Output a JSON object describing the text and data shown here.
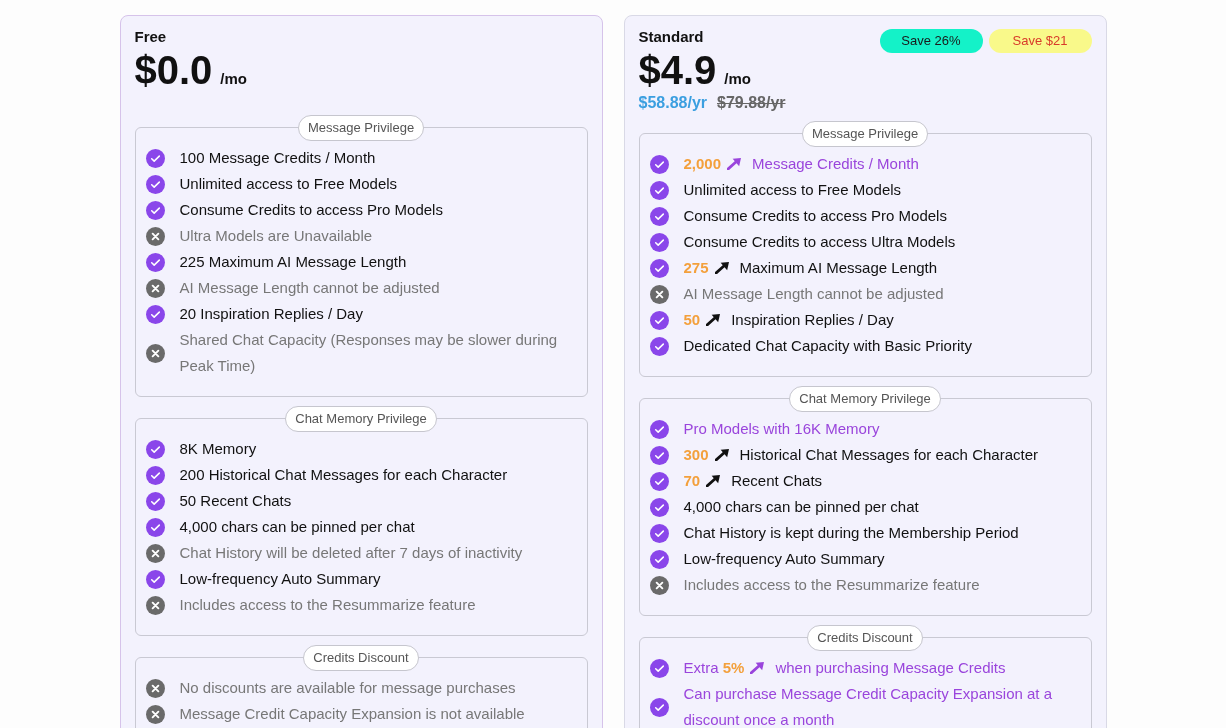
{
  "plans": [
    {
      "name": "Free",
      "price": "$0.0",
      "period": "/mo",
      "sections": [
        {
          "title": "Message Privilege",
          "features": [
            {
              "included": true,
              "highlight": false,
              "segments": [
                {
                  "kind": "text",
                  "text": "100 Message Credits / Month"
                }
              ]
            },
            {
              "included": true,
              "highlight": false,
              "segments": [
                {
                  "kind": "text",
                  "text": "Unlimited access to Free Models"
                }
              ]
            },
            {
              "included": true,
              "highlight": false,
              "segments": [
                {
                  "kind": "text",
                  "text": "Consume Credits to access Pro Models"
                }
              ]
            },
            {
              "included": false,
              "highlight": false,
              "segments": [
                {
                  "kind": "text",
                  "text": "Ultra Models are Unavailable"
                }
              ]
            },
            {
              "included": true,
              "highlight": false,
              "segments": [
                {
                  "kind": "text",
                  "text": "225 Maximum AI Message Length"
                }
              ]
            },
            {
              "included": false,
              "highlight": false,
              "segments": [
                {
                  "kind": "text",
                  "text": "AI Message Length cannot be adjusted"
                }
              ]
            },
            {
              "included": true,
              "highlight": false,
              "segments": [
                {
                  "kind": "text",
                  "text": "20 Inspiration Replies / Day"
                }
              ]
            },
            {
              "included": false,
              "highlight": false,
              "segments": [
                {
                  "kind": "text",
                  "text": "Shared Chat Capacity (Responses may be slower during Peak Time)"
                }
              ]
            }
          ]
        },
        {
          "title": "Chat Memory Privilege",
          "features": [
            {
              "included": true,
              "highlight": false,
              "segments": [
                {
                  "kind": "text",
                  "text": "8K Memory"
                }
              ]
            },
            {
              "included": true,
              "highlight": false,
              "segments": [
                {
                  "kind": "text",
                  "text": "200 Historical Chat Messages for each Character"
                }
              ]
            },
            {
              "included": true,
              "highlight": false,
              "segments": [
                {
                  "kind": "text",
                  "text": "50 Recent Chats"
                }
              ]
            },
            {
              "included": true,
              "highlight": false,
              "segments": [
                {
                  "kind": "text",
                  "text": "4,000 chars can be pinned per chat"
                }
              ]
            },
            {
              "included": false,
              "highlight": false,
              "segments": [
                {
                  "kind": "text",
                  "text": "Chat History will be deleted after 7 days of inactivity"
                }
              ]
            },
            {
              "included": true,
              "highlight": false,
              "segments": [
                {
                  "kind": "text",
                  "text": "Low-frequency Auto Summary"
                }
              ]
            },
            {
              "included": false,
              "highlight": false,
              "segments": [
                {
                  "kind": "text",
                  "text": "Includes access to the Resummarize feature"
                }
              ]
            }
          ]
        },
        {
          "title": "Credits Discount",
          "features": [
            {
              "included": false,
              "highlight": false,
              "segments": [
                {
                  "kind": "text",
                  "text": "No discounts are available for message purchases"
                }
              ]
            },
            {
              "included": false,
              "highlight": false,
              "segments": [
                {
                  "kind": "text",
                  "text": "Message Credit Capacity Expansion is not available"
                }
              ]
            }
          ]
        }
      ]
    },
    {
      "name": "Standard",
      "price": "$4.9",
      "period": "/mo",
      "yearly_price": "$58.88/yr",
      "original_yearly_price": "$79.88/yr",
      "badges": [
        {
          "kind": "percent",
          "text": "Save 26%",
          "color": "#14f2c8"
        },
        {
          "kind": "amount",
          "text": "Save $21",
          "color": "#f9f98a"
        }
      ],
      "sections": [
        {
          "title": "Message Privilege",
          "features": [
            {
              "included": true,
              "highlight": true,
              "segments": [
                {
                  "kind": "number",
                  "text": "2,000"
                },
                {
                  "kind": "arrow"
                },
                {
                  "kind": "text",
                  "text": "Message Credits / Month"
                }
              ]
            },
            {
              "included": true,
              "highlight": false,
              "segments": [
                {
                  "kind": "text",
                  "text": "Unlimited access to Free Models"
                }
              ]
            },
            {
              "included": true,
              "highlight": false,
              "segments": [
                {
                  "kind": "text",
                  "text": "Consume Credits to access Pro Models"
                }
              ]
            },
            {
              "included": true,
              "highlight": false,
              "segments": [
                {
                  "kind": "text",
                  "text": "Consume Credits to access Ultra Models"
                }
              ]
            },
            {
              "included": true,
              "highlight": false,
              "segments": [
                {
                  "kind": "number",
                  "text": "275"
                },
                {
                  "kind": "arrow"
                },
                {
                  "kind": "text",
                  "text": "Maximum AI Message Length"
                }
              ]
            },
            {
              "included": false,
              "highlight": false,
              "segments": [
                {
                  "kind": "text",
                  "text": "AI Message Length cannot be adjusted"
                }
              ]
            },
            {
              "included": true,
              "highlight": false,
              "segments": [
                {
                  "kind": "number",
                  "text": "50"
                },
                {
                  "kind": "arrow"
                },
                {
                  "kind": "text",
                  "text": "Inspiration Replies / Day"
                }
              ]
            },
            {
              "included": true,
              "highlight": false,
              "segments": [
                {
                  "kind": "text",
                  "text": "Dedicated Chat Capacity with Basic Priority"
                }
              ]
            }
          ]
        },
        {
          "title": "Chat Memory Privilege",
          "features": [
            {
              "included": true,
              "highlight": true,
              "segments": [
                {
                  "kind": "text",
                  "text": "Pro Models with 16K Memory"
                }
              ]
            },
            {
              "included": true,
              "highlight": false,
              "segments": [
                {
                  "kind": "number",
                  "text": "300"
                },
                {
                  "kind": "arrow"
                },
                {
                  "kind": "text",
                  "text": "Historical Chat Messages for each Character"
                }
              ]
            },
            {
              "included": true,
              "highlight": false,
              "segments": [
                {
                  "kind": "number",
                  "text": "70"
                },
                {
                  "kind": "arrow"
                },
                {
                  "kind": "text",
                  "text": "Recent Chats"
                }
              ]
            },
            {
              "included": true,
              "highlight": false,
              "segments": [
                {
                  "kind": "text",
                  "text": "4,000 chars can be pinned per chat"
                }
              ]
            },
            {
              "included": true,
              "highlight": false,
              "segments": [
                {
                  "kind": "text",
                  "text": "Chat History is kept during the Membership Period"
                }
              ]
            },
            {
              "included": true,
              "highlight": false,
              "segments": [
                {
                  "kind": "text",
                  "text": "Low-frequency Auto Summary"
                }
              ]
            },
            {
              "included": false,
              "highlight": false,
              "segments": [
                {
                  "kind": "text",
                  "text": "Includes access to the Resummarize feature"
                }
              ]
            }
          ]
        },
        {
          "title": "Credits Discount",
          "features": [
            {
              "included": true,
              "highlight": true,
              "segments": [
                {
                  "kind": "text",
                  "text": "Extra"
                },
                {
                  "kind": "number",
                  "text": "5%"
                },
                {
                  "kind": "arrow"
                },
                {
                  "kind": "text",
                  "text": "when purchasing Message Credits"
                }
              ]
            },
            {
              "included": true,
              "highlight": true,
              "segments": [
                {
                  "kind": "text",
                  "text": "Can purchase Message Credit Capacity Expansion at a discount once a month"
                }
              ]
            }
          ]
        }
      ]
    }
  ]
}
